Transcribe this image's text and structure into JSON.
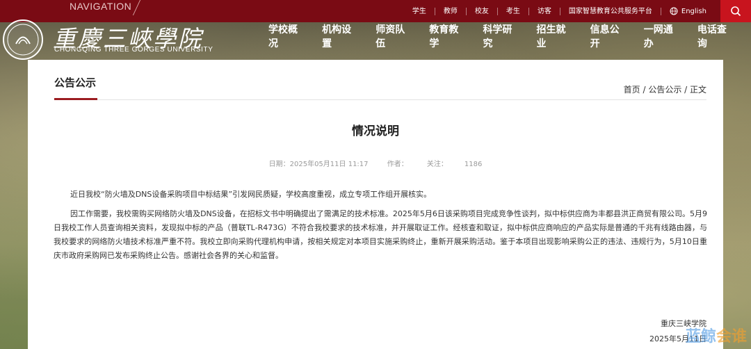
{
  "topbar": {
    "nav_label": "NAVIGATION",
    "links": [
      "学生",
      "教师",
      "校友",
      "考生",
      "访客",
      "国家智慧教育公共服务平台"
    ],
    "language": "English"
  },
  "logo": {
    "name_cn": "重慶三峽學院",
    "name_en": "CHONGQING THREE GORGES UNIVERSITY"
  },
  "mainnav": [
    "学校概况",
    "机构设置",
    "师资队伍",
    "教育教学",
    "科学研究",
    "招生就业",
    "信息公开",
    "一网通办",
    "电话查询"
  ],
  "section": {
    "title": "公告公示",
    "breadcrumb": "首页 / 公告公示 / 正文"
  },
  "article": {
    "title": "情况说明",
    "date": "日期：2025年05月11日 11:17",
    "author": "作者：",
    "views": "关注：",
    "views_count": "1186",
    "paragraph1": "近日我校“防火墙及DNS设备采购项目中标结果”引发网民质疑，学校高度重视，成立专项工作组开展核实。",
    "paragraph2": "因工作需要，我校需购买网络防火墙及DNS设备，在招标文书中明确提出了需满足的技术标准。2025年5月6日该采购项目完成竞争性谈判，拟中标供应商为丰都县洪正商贸有限公司。5月9日我校工作人员查询相关资料，发现拟中标的产品（普联TL-R473G）不符合我校要求的技术标准，并开展取证工作。经核查和取证，拟中标供应商响应的产品实际是普通的千兆有线路由器，与我校要求的网络防火墙技术标准严重不符。我校立即向采购代理机构申请，按相关规定对本项目实施采购终止，重新开展采购活动。鉴于本项目出现影响采购公正的违法、违规行为，5月10日重庆市政府采购网已发布采购终止公告。感谢社会各界的关心和监督。",
    "signature": "重庆三峡学院",
    "sign_date": "2025年5月11日"
  },
  "watermark": {
    "part1": "蓝鲸",
    "part2": "会谁"
  }
}
